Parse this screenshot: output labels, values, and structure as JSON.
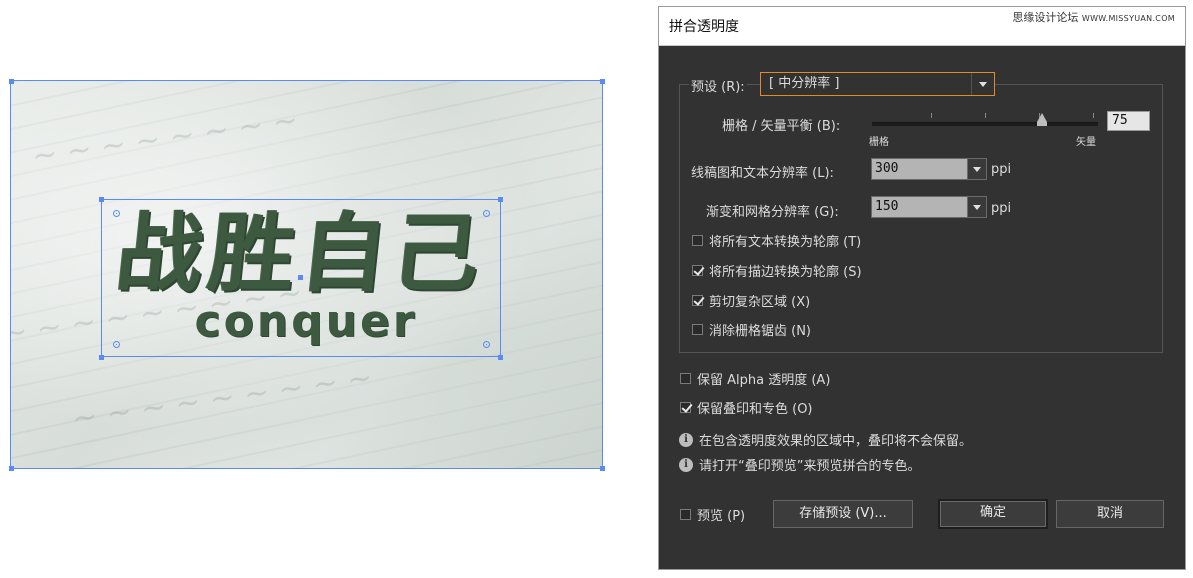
{
  "artwork": {
    "logo_line1": "战胜自己",
    "logo_line2": "conquer"
  },
  "dialog": {
    "title": "拼合透明度",
    "watermark_cn": "思缘设计论坛",
    "watermark_en": "WWW.MISSYUAN.COM",
    "preset": {
      "label": "预设 (R):",
      "value": "[ 中分辨率 ]"
    },
    "balance": {
      "label": "栅格 / 矢量平衡 (B):",
      "left_label": "栅格",
      "right_label": "矢量",
      "value": "75",
      "level_percent": 75
    },
    "line_art_res": {
      "label": "线稿图和文本分辨率 (L):",
      "value": "300",
      "unit": "ppi"
    },
    "gradient_res": {
      "label": "渐变和网格分辨率 (G):",
      "value": "150",
      "unit": "ppi"
    },
    "options": [
      {
        "label": "将所有文本转换为轮廓 (T)",
        "checked": false
      },
      {
        "label": "将所有描边转换为轮廓 (S)",
        "checked": true
      },
      {
        "label": "剪切复杂区域 (X)",
        "checked": true
      },
      {
        "label": "消除栅格锯齿 (N)",
        "checked": false
      }
    ],
    "preserve_alpha": {
      "label": "保留 Alpha 透明度 (A)",
      "checked": false
    },
    "preserve_overprint": {
      "label": "保留叠印和专色 (O)",
      "checked": true
    },
    "info": [
      "在包含透明度效果的区域中，叠印将不会保留。",
      "请打开“叠印预览”来预览拼合的专色。"
    ],
    "preview": {
      "label": "预览 (P)",
      "checked": false
    },
    "save_preset_label": "存储预设 (V)...",
    "ok_label": "确定",
    "cancel_label": "取消"
  },
  "colors": {
    "dialog_bg": "#323232",
    "focus_orange": "#e68a28",
    "selection_blue": "#5a8bf0",
    "logo_green": "#3d5a40"
  }
}
